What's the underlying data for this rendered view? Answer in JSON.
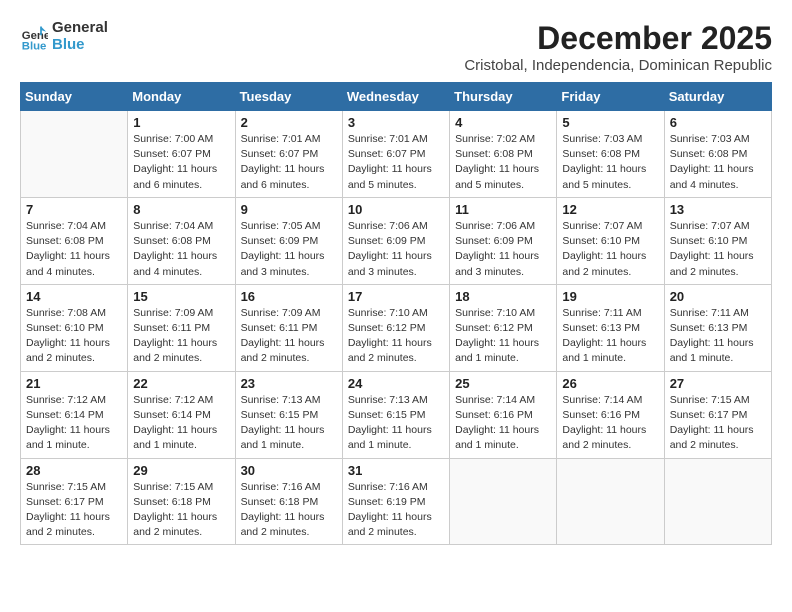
{
  "header": {
    "logo_general": "General",
    "logo_blue": "Blue",
    "month_title": "December 2025",
    "location": "Cristobal, Independencia, Dominican Republic"
  },
  "calendar": {
    "days_of_week": [
      "Sunday",
      "Monday",
      "Tuesday",
      "Wednesday",
      "Thursday",
      "Friday",
      "Saturday"
    ],
    "weeks": [
      [
        {
          "day": "",
          "info": ""
        },
        {
          "day": "1",
          "info": "Sunrise: 7:00 AM\nSunset: 6:07 PM\nDaylight: 11 hours\nand 6 minutes."
        },
        {
          "day": "2",
          "info": "Sunrise: 7:01 AM\nSunset: 6:07 PM\nDaylight: 11 hours\nand 6 minutes."
        },
        {
          "day": "3",
          "info": "Sunrise: 7:01 AM\nSunset: 6:07 PM\nDaylight: 11 hours\nand 5 minutes."
        },
        {
          "day": "4",
          "info": "Sunrise: 7:02 AM\nSunset: 6:08 PM\nDaylight: 11 hours\nand 5 minutes."
        },
        {
          "day": "5",
          "info": "Sunrise: 7:03 AM\nSunset: 6:08 PM\nDaylight: 11 hours\nand 5 minutes."
        },
        {
          "day": "6",
          "info": "Sunrise: 7:03 AM\nSunset: 6:08 PM\nDaylight: 11 hours\nand 4 minutes."
        }
      ],
      [
        {
          "day": "7",
          "info": "Sunrise: 7:04 AM\nSunset: 6:08 PM\nDaylight: 11 hours\nand 4 minutes."
        },
        {
          "day": "8",
          "info": "Sunrise: 7:04 AM\nSunset: 6:08 PM\nDaylight: 11 hours\nand 4 minutes."
        },
        {
          "day": "9",
          "info": "Sunrise: 7:05 AM\nSunset: 6:09 PM\nDaylight: 11 hours\nand 3 minutes."
        },
        {
          "day": "10",
          "info": "Sunrise: 7:06 AM\nSunset: 6:09 PM\nDaylight: 11 hours\nand 3 minutes."
        },
        {
          "day": "11",
          "info": "Sunrise: 7:06 AM\nSunset: 6:09 PM\nDaylight: 11 hours\nand 3 minutes."
        },
        {
          "day": "12",
          "info": "Sunrise: 7:07 AM\nSunset: 6:10 PM\nDaylight: 11 hours\nand 2 minutes."
        },
        {
          "day": "13",
          "info": "Sunrise: 7:07 AM\nSunset: 6:10 PM\nDaylight: 11 hours\nand 2 minutes."
        }
      ],
      [
        {
          "day": "14",
          "info": "Sunrise: 7:08 AM\nSunset: 6:10 PM\nDaylight: 11 hours\nand 2 minutes."
        },
        {
          "day": "15",
          "info": "Sunrise: 7:09 AM\nSunset: 6:11 PM\nDaylight: 11 hours\nand 2 minutes."
        },
        {
          "day": "16",
          "info": "Sunrise: 7:09 AM\nSunset: 6:11 PM\nDaylight: 11 hours\nand 2 minutes."
        },
        {
          "day": "17",
          "info": "Sunrise: 7:10 AM\nSunset: 6:12 PM\nDaylight: 11 hours\nand 2 minutes."
        },
        {
          "day": "18",
          "info": "Sunrise: 7:10 AM\nSunset: 6:12 PM\nDaylight: 11 hours\nand 1 minute."
        },
        {
          "day": "19",
          "info": "Sunrise: 7:11 AM\nSunset: 6:13 PM\nDaylight: 11 hours\nand 1 minute."
        },
        {
          "day": "20",
          "info": "Sunrise: 7:11 AM\nSunset: 6:13 PM\nDaylight: 11 hours\nand 1 minute."
        }
      ],
      [
        {
          "day": "21",
          "info": "Sunrise: 7:12 AM\nSunset: 6:14 PM\nDaylight: 11 hours\nand 1 minute."
        },
        {
          "day": "22",
          "info": "Sunrise: 7:12 AM\nSunset: 6:14 PM\nDaylight: 11 hours\nand 1 minute."
        },
        {
          "day": "23",
          "info": "Sunrise: 7:13 AM\nSunset: 6:15 PM\nDaylight: 11 hours\nand 1 minute."
        },
        {
          "day": "24",
          "info": "Sunrise: 7:13 AM\nSunset: 6:15 PM\nDaylight: 11 hours\nand 1 minute."
        },
        {
          "day": "25",
          "info": "Sunrise: 7:14 AM\nSunset: 6:16 PM\nDaylight: 11 hours\nand 1 minute."
        },
        {
          "day": "26",
          "info": "Sunrise: 7:14 AM\nSunset: 6:16 PM\nDaylight: 11 hours\nand 2 minutes."
        },
        {
          "day": "27",
          "info": "Sunrise: 7:15 AM\nSunset: 6:17 PM\nDaylight: 11 hours\nand 2 minutes."
        }
      ],
      [
        {
          "day": "28",
          "info": "Sunrise: 7:15 AM\nSunset: 6:17 PM\nDaylight: 11 hours\nand 2 minutes."
        },
        {
          "day": "29",
          "info": "Sunrise: 7:15 AM\nSunset: 6:18 PM\nDaylight: 11 hours\nand 2 minutes."
        },
        {
          "day": "30",
          "info": "Sunrise: 7:16 AM\nSunset: 6:18 PM\nDaylight: 11 hours\nand 2 minutes."
        },
        {
          "day": "31",
          "info": "Sunrise: 7:16 AM\nSunset: 6:19 PM\nDaylight: 11 hours\nand 2 minutes."
        },
        {
          "day": "",
          "info": ""
        },
        {
          "day": "",
          "info": ""
        },
        {
          "day": "",
          "info": ""
        }
      ]
    ]
  }
}
